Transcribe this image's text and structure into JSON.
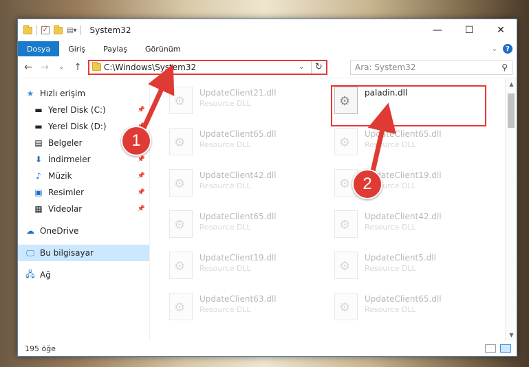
{
  "window": {
    "title": "System32"
  },
  "ribbon": {
    "tabs": [
      "Dosya",
      "Giriş",
      "Paylaş",
      "Görünüm"
    ]
  },
  "nav": {
    "address": "C:\\Windows\\System32",
    "search_placeholder": "Ara: System32"
  },
  "sidebar": {
    "quick_access": "Hızlı erişim",
    "items": [
      {
        "label": "Yerel Disk (C:)",
        "icon": "drive-icon",
        "pinned": true
      },
      {
        "label": "Yerel Disk (D:)",
        "icon": "drive-icon",
        "pinned": true
      },
      {
        "label": "Belgeler",
        "icon": "documents-icon",
        "pinned": true
      },
      {
        "label": "İndirmeler",
        "icon": "download-icon",
        "pinned": true
      },
      {
        "label": "Müzik",
        "icon": "music-icon",
        "pinned": true
      },
      {
        "label": "Resimler",
        "icon": "pictures-icon",
        "pinned": true
      },
      {
        "label": "Videolar",
        "icon": "video-icon",
        "pinned": true
      }
    ],
    "onedrive": "OneDrive",
    "this_pc": "Bu bilgisayar",
    "network": "Ağ"
  },
  "files": {
    "highlighted": {
      "name": "paladin.dll",
      "desc": ""
    },
    "left_column": [
      {
        "name": "UpdateClient21.dll",
        "desc": "Resource DLL"
      },
      {
        "name": "UpdateClient65.dll",
        "desc": "Resource DLL"
      },
      {
        "name": "UpdateClient42.dll",
        "desc": "Resource DLL"
      },
      {
        "name": "UpdateClient65.dll",
        "desc": "Resource DLL"
      },
      {
        "name": "UpdateClient19.dll",
        "desc": "Resource DLL"
      },
      {
        "name": "UpdateClient63.dll",
        "desc": "Resource DLL"
      }
    ],
    "right_column": [
      {
        "name": "UpdateClient65.dll",
        "desc": "Resource DLL"
      },
      {
        "name": "UpdateClient19.dll",
        "desc": "Resource DLL"
      },
      {
        "name": "UpdateClient42.dll",
        "desc": "Resource DLL"
      },
      {
        "name": "UpdateClient5.dll",
        "desc": "Resource DLL"
      },
      {
        "name": "UpdateClient65.dll",
        "desc": "Resource DLL"
      }
    ]
  },
  "annotations": {
    "step1": "1",
    "step2": "2"
  },
  "status": {
    "count": "195 öğe"
  },
  "colors": {
    "accent": "#1f6fc5",
    "highlight": "#e53935",
    "badge": "#e03a35"
  }
}
